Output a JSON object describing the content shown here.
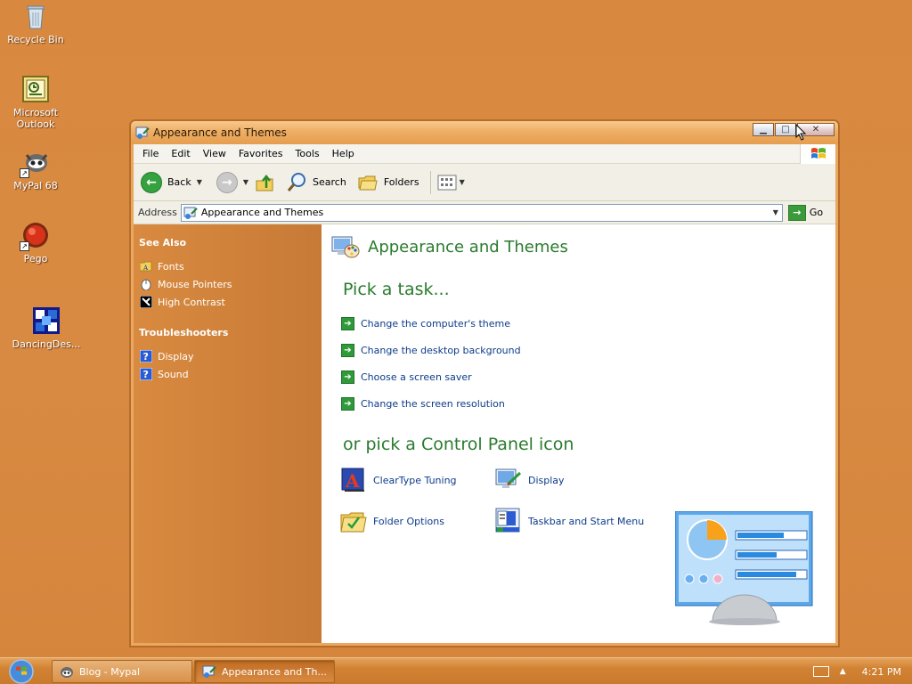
{
  "desktop": {
    "icons": [
      {
        "label": "Recycle Bin",
        "icon": "recycle-bin-icon"
      },
      {
        "label": "Microsoft Outlook",
        "icon": "outlook-icon"
      },
      {
        "label": "MyPal 68",
        "icon": "mypal-icon"
      },
      {
        "label": "Pego",
        "icon": "pego-icon"
      },
      {
        "label": "DancingDes...",
        "icon": "dancing-desktop-icon"
      }
    ]
  },
  "window": {
    "title": "Appearance and Themes",
    "menu": [
      "File",
      "Edit",
      "View",
      "Favorites",
      "Tools",
      "Help"
    ],
    "toolbar": {
      "back": "Back",
      "search": "Search",
      "folders": "Folders"
    },
    "address": {
      "label": "Address",
      "value": "Appearance and Themes",
      "go": "Go"
    },
    "sidebar": {
      "see_also": {
        "title": "See Also",
        "items": [
          "Fonts",
          "Mouse Pointers",
          "High Contrast"
        ]
      },
      "troubleshooters": {
        "title": "Troubleshooters",
        "items": [
          "Display",
          "Sound"
        ]
      }
    },
    "main": {
      "heading": "Appearance and Themes",
      "pick_task": "Pick a task...",
      "tasks": [
        "Change the computer's theme",
        "Change the desktop background",
        "Choose a screen saver",
        "Change the screen resolution"
      ],
      "or_pick": "or pick a Control Panel icon",
      "icons": [
        {
          "label": "ClearType Tuning",
          "icon": "cleartype-icon"
        },
        {
          "label": "Display",
          "icon": "display-icon"
        },
        {
          "label": "Folder Options",
          "icon": "folder-options-icon"
        },
        {
          "label": "Taskbar and Start Menu",
          "icon": "taskbar-start-menu-icon"
        }
      ]
    }
  },
  "taskbar": {
    "buttons": [
      "Blog - Mypal",
      "Appearance and Th..."
    ],
    "clock": "4:21 PM"
  },
  "colors": {
    "desktop_bg": "#d9893f",
    "heading_green": "#2a7b2e",
    "link_blue": "#0c3b8a",
    "sidebar_orange": "#d98a40"
  }
}
